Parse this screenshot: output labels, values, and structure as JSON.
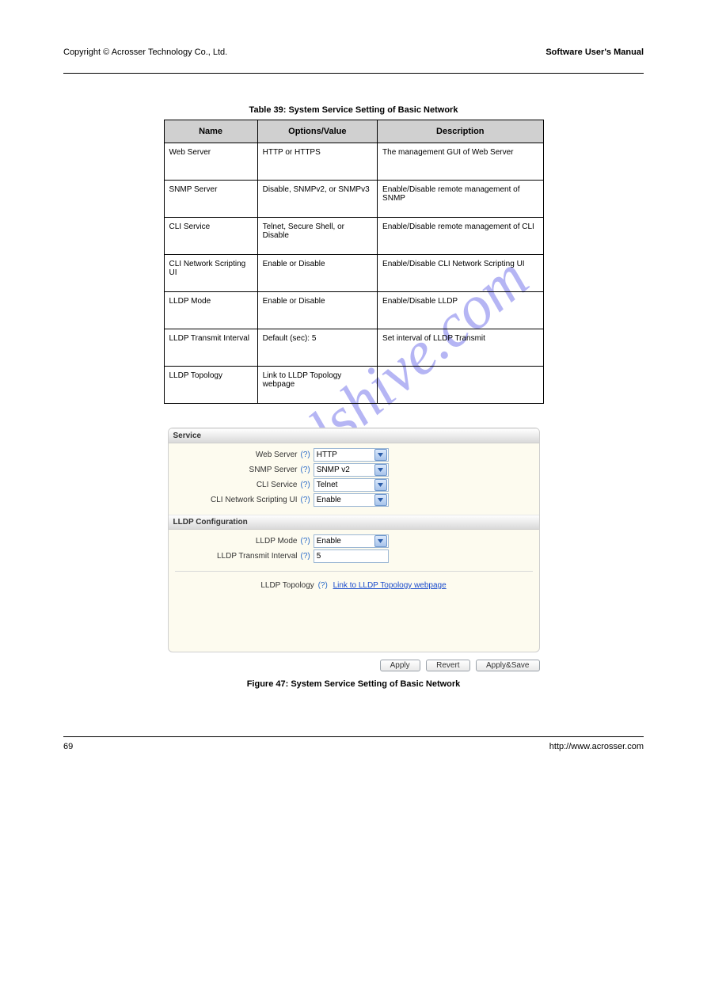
{
  "watermark": "manualshive.com",
  "header": {
    "copyright": "Copyright © Acrosser Technology Co., Ltd.",
    "title": "Software User's Manual"
  },
  "footer": {
    "page": "69",
    "site": "http://www.acrosser.com"
  },
  "table": {
    "caption": "Table 39: System Service Setting of Basic Network",
    "headers": [
      "Name",
      "Options/Value",
      "Description"
    ],
    "rows": [
      [
        "Web Server",
        "HTTP or HTTPS",
        "The management GUI of Web Server"
      ],
      [
        "SNMP Server",
        "Disable, SNMPv2, or SNMPv3",
        "Enable/Disable remote management of SNMP"
      ],
      [
        "CLI Service",
        "Telnet, Secure Shell, or Disable",
        "Enable/Disable remote management of CLI"
      ],
      [
        "CLI Network Scripting UI",
        "Enable or Disable",
        "Enable/Disable CLI Network Scripting UI"
      ],
      [
        "LLDP Mode",
        "Enable or Disable",
        "Enable/Disable LLDP"
      ],
      [
        "LLDP Transmit Interval",
        "Default (sec): 5",
        "Set interval of LLDP Transmit"
      ],
      [
        "LLDP Topology",
        "Link to LLDP Topology webpage",
        ""
      ]
    ]
  },
  "panel": {
    "section_service": "Service",
    "section_lldp": "LLDP Configuration",
    "fields": {
      "web_server": {
        "label": "Web Server",
        "value": "HTTP"
      },
      "snmp_server": {
        "label": "SNMP Server",
        "value": "SNMP v2"
      },
      "cli_service": {
        "label": "CLI Service",
        "value": "Telnet"
      },
      "cli_scripting": {
        "label": "CLI Network Scripting UI",
        "value": "Enable"
      },
      "lldp_mode": {
        "label": "LLDP Mode",
        "value": "Enable"
      },
      "lldp_interval": {
        "label": "LLDP Transmit Interval",
        "value": "5"
      },
      "lldp_topology": {
        "label": "LLDP Topology",
        "link_text": "Link to LLDP Topology webpage"
      }
    },
    "q": "(?)",
    "buttons": {
      "apply": "Apply",
      "revert": "Revert",
      "applysave": "Apply&Save"
    }
  },
  "figure_caption": "Figure 47: System Service Setting of Basic Network"
}
